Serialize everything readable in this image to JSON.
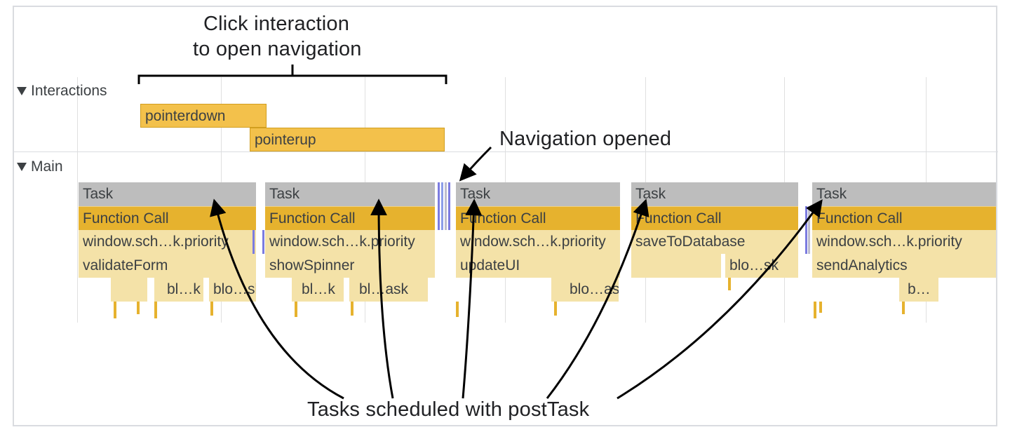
{
  "annotations": {
    "top_line1": "Click interaction",
    "top_line2": "to open navigation",
    "nav_opened": "Navigation opened",
    "bottom": "Tasks scheduled with postTask"
  },
  "tracks": {
    "interactions_label": "Interactions",
    "main_label": "Main"
  },
  "interactions": {
    "pointerdown": "pointerdown",
    "pointerup": "pointerup"
  },
  "main": {
    "task_label": "Task",
    "function_call_label": "Function Call",
    "columns": [
      {
        "row3": "window.sch…k.priority",
        "row4": "validateForm",
        "row5": [
          "bl…k",
          "blo…sk"
        ]
      },
      {
        "row3": "window.sch…k.priority",
        "row4": "showSpinner",
        "row5": [
          "bl…k",
          "bl…ask"
        ]
      },
      {
        "row3": "window.sch…k.priority",
        "row4": "updateUI",
        "row5": [
          "blo…ask"
        ]
      },
      {
        "row3": "saveToDatabase",
        "row4": "blo…sk",
        "row5": []
      },
      {
        "row3": "window.sch…k.priority",
        "row4": "sendAnalytics",
        "row5": [
          "b…"
        ]
      }
    ]
  },
  "colors": {
    "interaction_bar": "#f3c14b",
    "task_bar": "#bdbdbd",
    "function_bar": "#e6b22e",
    "sub_bar": "#f4e2a8",
    "stripe": "#7b7be0",
    "gridline": "#e0e0e0"
  }
}
